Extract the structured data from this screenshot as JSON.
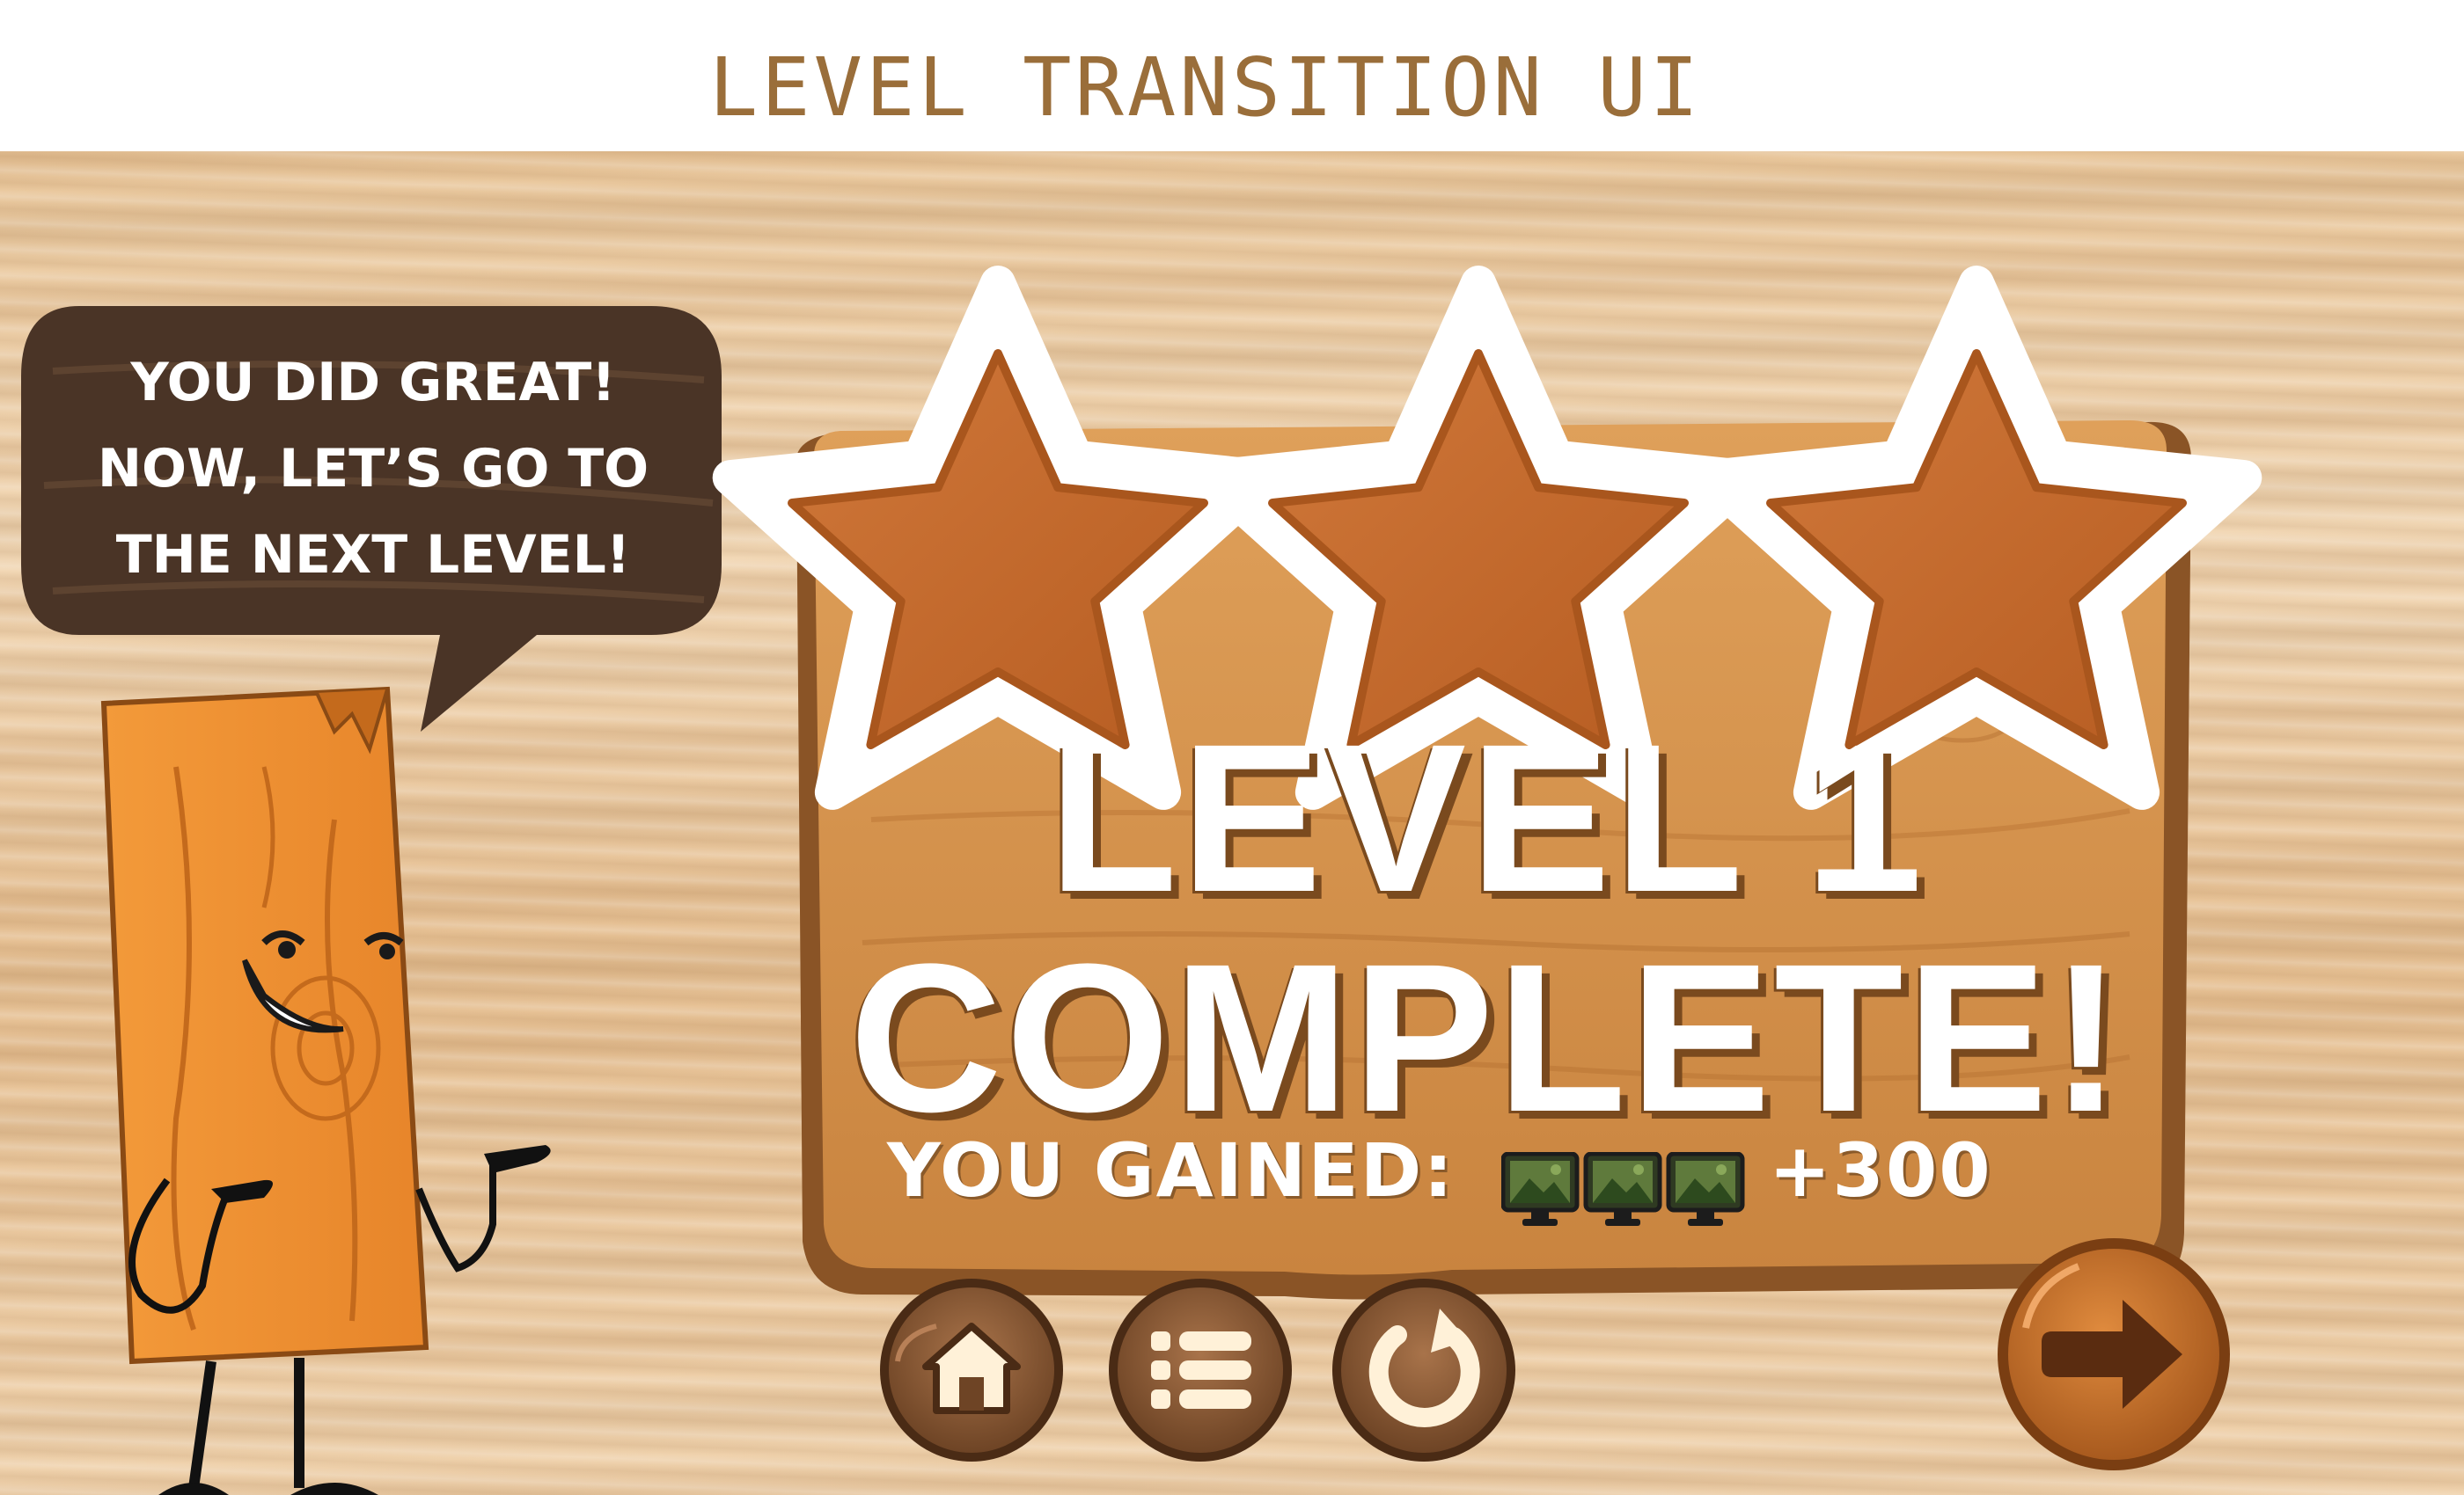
{
  "header": {
    "title": "LEVEL TRANSITION UI"
  },
  "character": {
    "speech_lines": [
      "YOU DID GREAT!",
      "NOW, LET’S GO TO",
      "THE NEXT LEVEL!"
    ]
  },
  "stars": {
    "earned": 3,
    "total": 3
  },
  "result": {
    "title_line1": "LEVEL 1",
    "title_line2": "COMPLETE!",
    "gained_label": "YOU GAINED:",
    "reward_icon": "picture-frame-icon",
    "reward_icon_count": 3,
    "gained_value": "+300"
  },
  "buttons": [
    "home-icon",
    "list-menu-icon",
    "replay-icon",
    "next-arrow-icon"
  ],
  "colors": {
    "heading": "#9a6e3a",
    "wood_board": "#d2914a",
    "star_fill": "#c56a2b",
    "button": "#8b5a33",
    "next_button": "#c8742e"
  }
}
